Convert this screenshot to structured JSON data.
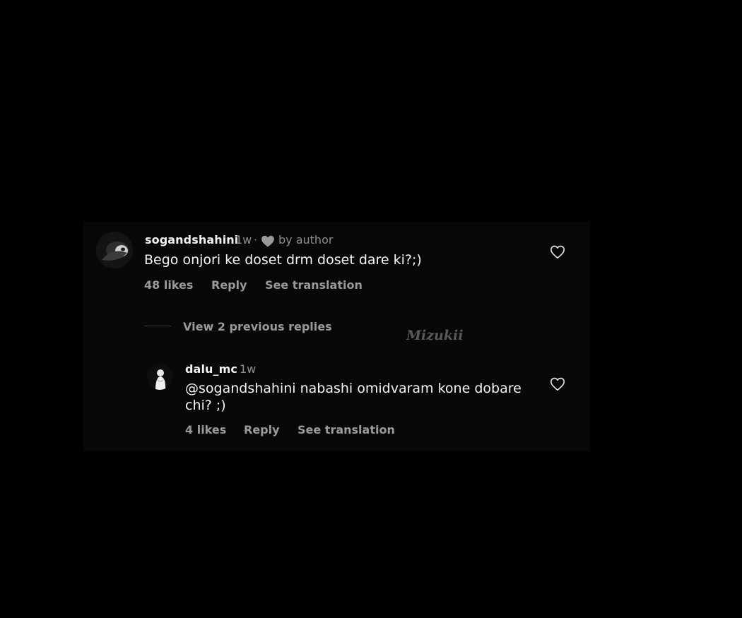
{
  "comment": {
    "username": "sogandshahini",
    "time": "1w",
    "separator": "·",
    "liked_by_author": "by author",
    "text": "Bego onjori ke doset drm doset dare ki?;)",
    "likes": "48 likes",
    "reply_label": "Reply",
    "translate_label": "See translation",
    "avatar_icon": "profile-photo",
    "like_icon": "heart-outline-icon"
  },
  "view_replies": {
    "label": "View 2 previous replies"
  },
  "reply": {
    "username": "dalu_mc",
    "time": "1w",
    "text_line1": "@sogandshahini nabashi omidvaram kone dobare",
    "text_line2": "chi? ;)",
    "likes": "4 likes",
    "reply_label": "Reply",
    "translate_label": "See translation",
    "avatar_icon": "profile-photo",
    "like_icon": "heart-outline-icon"
  },
  "watermark": {
    "text": "Mizukii"
  },
  "colors": {
    "background": "#000000",
    "panel": "#080808",
    "primary_text": "#f5f5f5",
    "secondary_text": "#8e8e8e"
  }
}
